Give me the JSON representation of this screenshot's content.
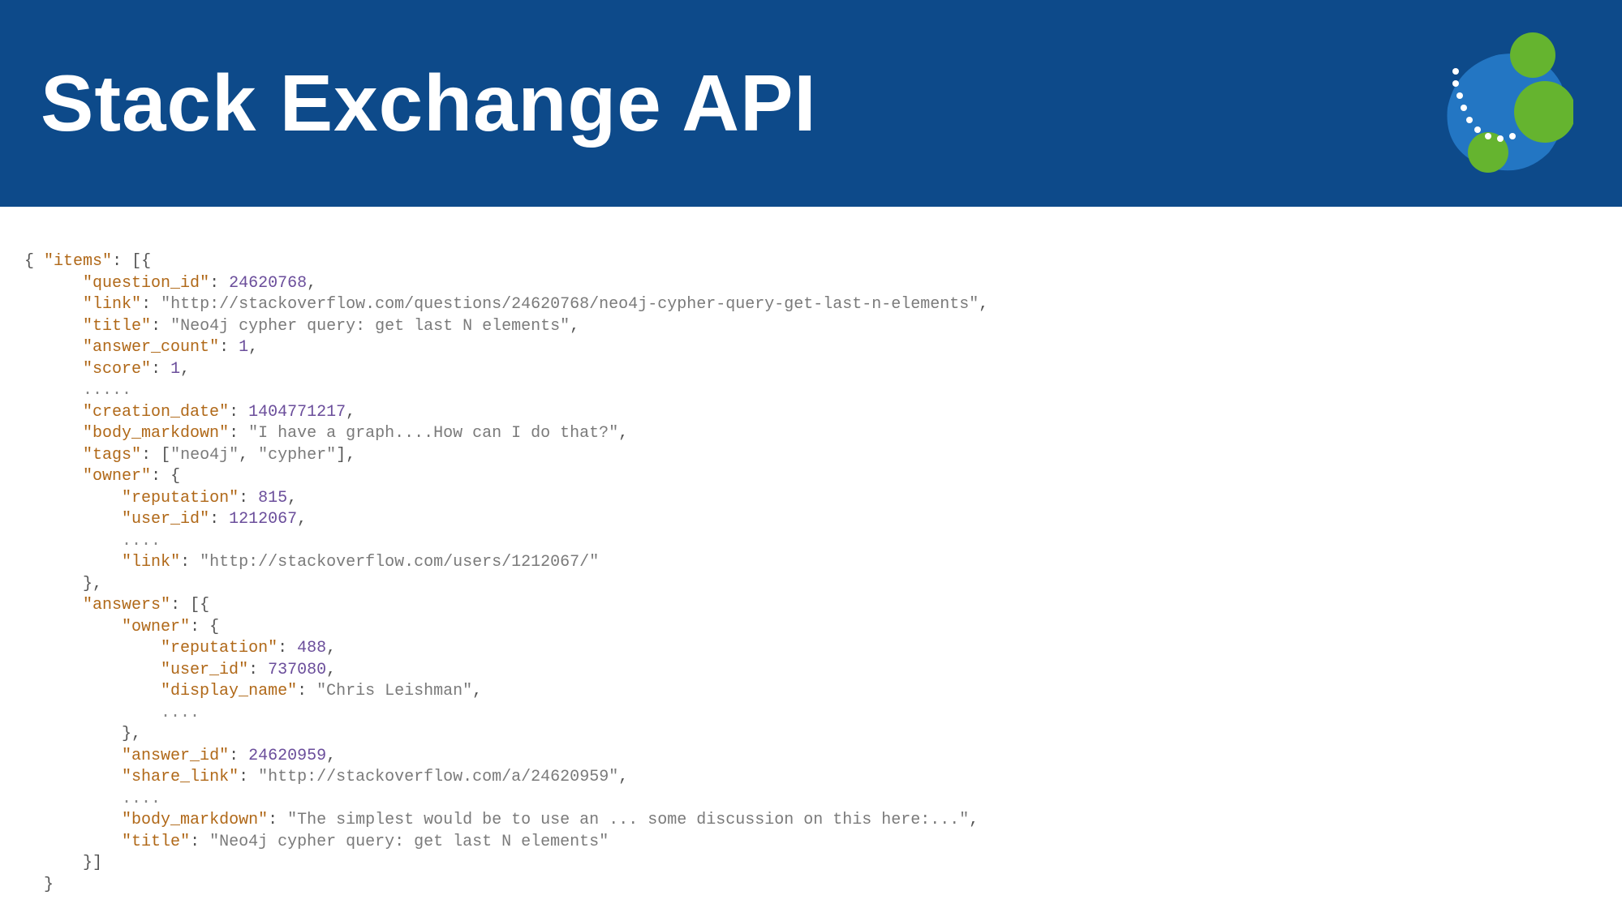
{
  "header": {
    "title": "Stack Exchange API"
  },
  "json_response": {
    "items_key": "items",
    "question_id_key": "question_id",
    "question_id": 24620768,
    "link_key": "link",
    "link": "http://stackoverflow.com/questions/24620768/neo4j-cypher-query-get-last-n-elements",
    "title_key": "title",
    "title_val": "Neo4j cypher query: get last N elements",
    "answer_count_key": "answer_count",
    "answer_count": 1,
    "score_key": "score",
    "score": 1,
    "ellipsis": ".....",
    "creation_date_key": "creation_date",
    "creation_date": 1404771217,
    "body_markdown_key": "body_markdown",
    "body_markdown": "I have a graph....How can I do that?",
    "tags_key": "tags",
    "tag1": "neo4j",
    "tag2": "cypher",
    "owner_key": "owner",
    "reputation_key": "reputation",
    "owner_reputation": 815,
    "user_id_key": "user_id",
    "owner_user_id": 1212067,
    "ellipsis4": "....",
    "owner_link": "http://stackoverflow.com/users/1212067/",
    "answers_key": "answers",
    "answer_owner_reputation": 488,
    "answer_owner_user_id": 737080,
    "display_name_key": "display_name",
    "answer_owner_display_name": "Chris Leishman",
    "answer_id_key": "answer_id",
    "answer_id": 24620959,
    "share_link_key": "share_link",
    "share_link": "http://stackoverflow.com/a/24620959",
    "answer_body_markdown": "The simplest would be to use an ... some discussion on this here:...",
    "answer_title": "Neo4j cypher query: get last N elements"
  }
}
